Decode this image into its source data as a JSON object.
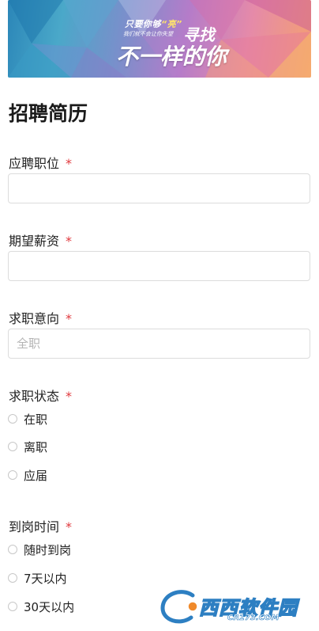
{
  "banner": {
    "line1_prefix": "只要你够",
    "line1_accent": "“亮”",
    "find": "寻找",
    "subline": "我们就不会让你失望",
    "main": "不一样的你"
  },
  "form": {
    "title": "招聘简历",
    "required_mark": "*",
    "position": {
      "label": "应聘职位",
      "value": "",
      "placeholder": ""
    },
    "salary": {
      "label": "期望薪资",
      "value": "",
      "placeholder": ""
    },
    "intent": {
      "label": "求职意向",
      "value": "",
      "placeholder": "全职"
    },
    "status": {
      "label": "求职状态",
      "options": [
        "在职",
        "离职",
        "应届"
      ]
    },
    "arrival": {
      "label": "到岗时间",
      "options": [
        "随时到岗",
        "7天以内",
        "30天以内"
      ]
    }
  },
  "watermark": {
    "name": "西西软件园",
    "url": "CR173.COM"
  }
}
